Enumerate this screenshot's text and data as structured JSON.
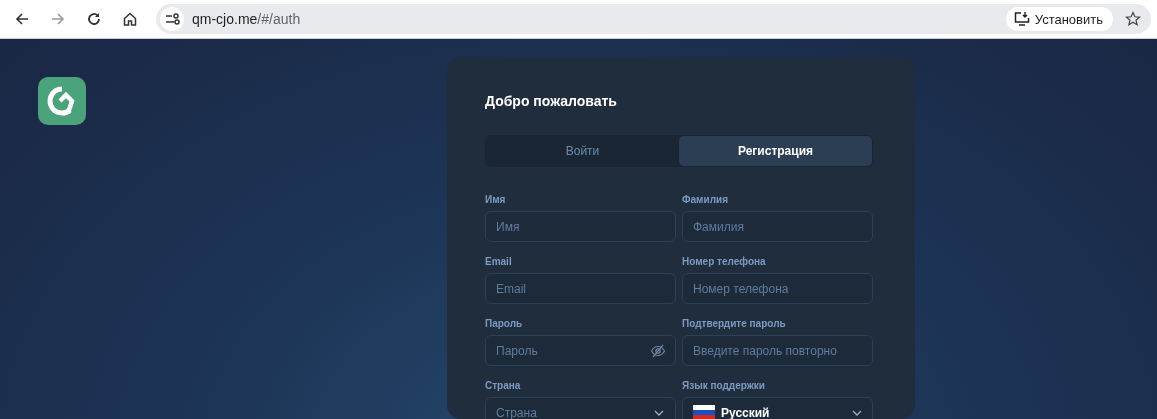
{
  "browser": {
    "url_host": "qm-cjo.me",
    "url_path": "/#/auth",
    "install_button": "Установить"
  },
  "card": {
    "title": "Добро пожаловать",
    "tabs": [
      {
        "label": "Войти",
        "selected": false
      },
      {
        "label": "Регистрация",
        "selected": true
      }
    ],
    "fields": [
      {
        "kind": "text",
        "label": "Имя",
        "placeholder": "Имя"
      },
      {
        "kind": "text",
        "label": "Фамилия",
        "placeholder": "Фамилия"
      },
      {
        "kind": "text",
        "label": "Email",
        "placeholder": "Email"
      },
      {
        "kind": "text",
        "label": "Номер телефона",
        "placeholder": "Номер телефона"
      },
      {
        "kind": "password",
        "label": "Пароль",
        "placeholder": "Пароль"
      },
      {
        "kind": "text",
        "label": "Подтвердите пароль",
        "placeholder": "Введите пароль повторно"
      },
      {
        "kind": "select",
        "label": "Страна",
        "placeholder": "Страна"
      },
      {
        "kind": "language",
        "label": "Язык поддержки",
        "value": "Русский"
      }
    ]
  }
}
